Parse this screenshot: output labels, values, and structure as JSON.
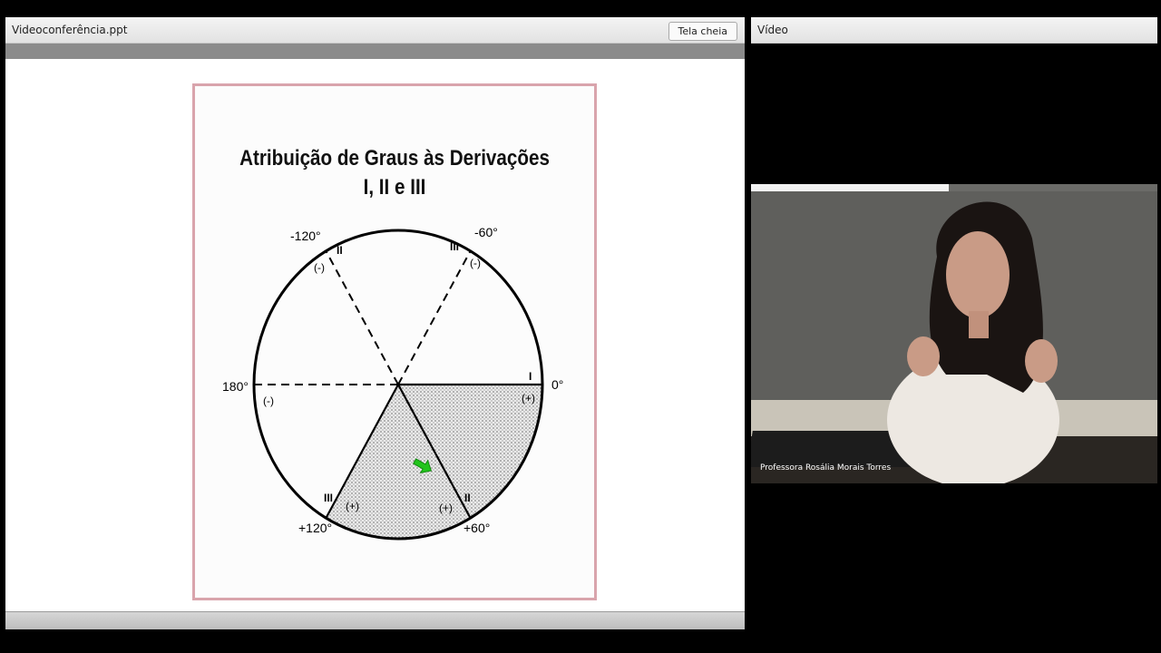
{
  "share": {
    "title": "Videoconferência.ppt",
    "fullscreen_label": "Tela cheia"
  },
  "slide": {
    "title_line1": "Atribuição de Graus às Derivações",
    "title_line2": "I, II e III",
    "angles": {
      "m120": "-120°",
      "m60": "-60°",
      "a180": "180°",
      "a0": "0°",
      "p120": "+120°",
      "p60": "+60°"
    },
    "leads": {
      "I": "I",
      "II": "II",
      "III": "III"
    },
    "signs": {
      "neg": "(-)",
      "pos": "(+)"
    }
  },
  "video": {
    "title": "Vídeo",
    "caption": "Professora Rosália Morais Torres"
  }
}
